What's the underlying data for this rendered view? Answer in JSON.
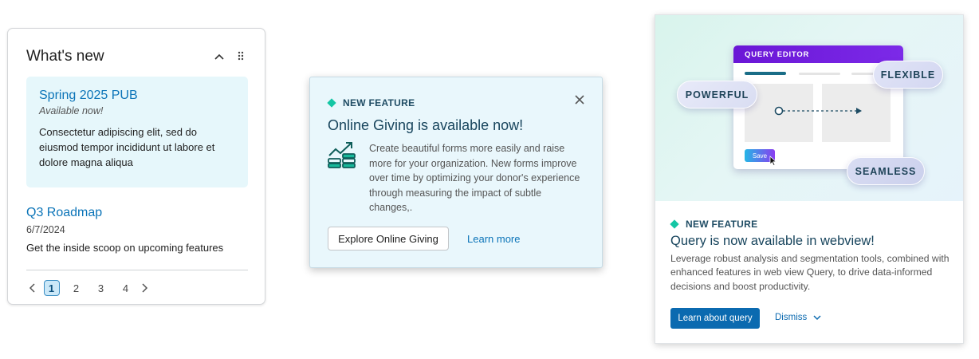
{
  "whats_new": {
    "title": "What's new",
    "items": [
      {
        "title": "Spring 2025 PUB",
        "subtitle": "Available now!",
        "body": "Consectetur adipiscing elit, sed do eiusmod tempor incididunt ut labore et dolore magna aliqua"
      },
      {
        "title": "Q3 Roadmap",
        "subtitle": "6/7/2024",
        "body": "Get the inside scoop on upcoming features"
      }
    ],
    "pagination": {
      "pages": [
        "1",
        "2",
        "3",
        "4"
      ],
      "current": "1"
    }
  },
  "online_giving": {
    "tag": "NEW FEATURE",
    "title": "Online Giving is available now!",
    "body": "Create beautiful forms more easily and raise more for your organization. New forms improve over time by optimizing your donor's experience through measuring the impact of subtle changes,.",
    "primary_button": "Explore Online Giving",
    "secondary_link": "Learn more"
  },
  "query_card": {
    "hero": {
      "window_title": "QUERY EDITOR",
      "save_label": "Save",
      "pills": [
        "POWERFUL",
        "FLEXIBLE",
        "SEAMLESS"
      ]
    },
    "tag": "NEW FEATURE",
    "title": "Query is now available in webview!",
    "body": "Leverage robust analysis and segmentation tools, combined with enhanced features in web view Query, to drive data-informed decisions and boost productivity.",
    "primary_button": "Learn about query",
    "dismiss_label": "Dismiss"
  },
  "colors": {
    "accent": "#0b74b8",
    "tag_diamond": "#14c6a4",
    "title_text": "#18455d",
    "query_header": "#6a16d6"
  }
}
